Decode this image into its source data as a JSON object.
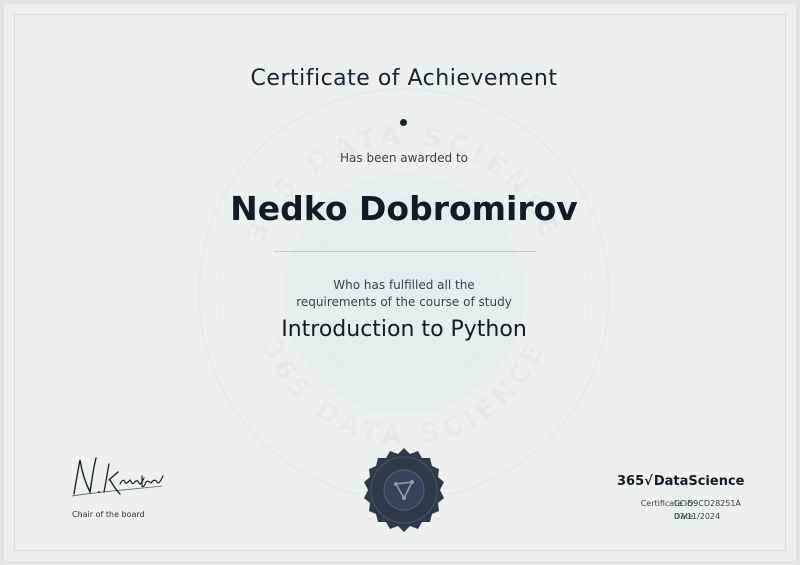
{
  "certificate": {
    "title": "Certificate of Achievement",
    "awarded_text": "Has been awarded to",
    "recipient_name": "Nedko Dobromirov",
    "fulfilled_line1": "Who has fulfilled all the",
    "fulfilled_line2": "requirements of the course of study",
    "course_name": "Introduction to Python"
  },
  "signature": {
    "signature_text": "N.Krastev",
    "role": "Chair of the board"
  },
  "brand": {
    "number": "365",
    "radical": "√",
    "name": "DataScience"
  },
  "watermark": {
    "text_top": "365 DATA SCIENCE",
    "text_bottom": "365 DATA SCIENCE"
  },
  "meta": {
    "certificate_id_label": "Certificate ID:",
    "certificate_id_value": "CC-59CD28251A",
    "date_label": "Date:",
    "date_value": "07/11/2024"
  },
  "colors": {
    "background": "#eef0f0",
    "text_dark": "#151a26",
    "seal": "#2f3a4b"
  }
}
